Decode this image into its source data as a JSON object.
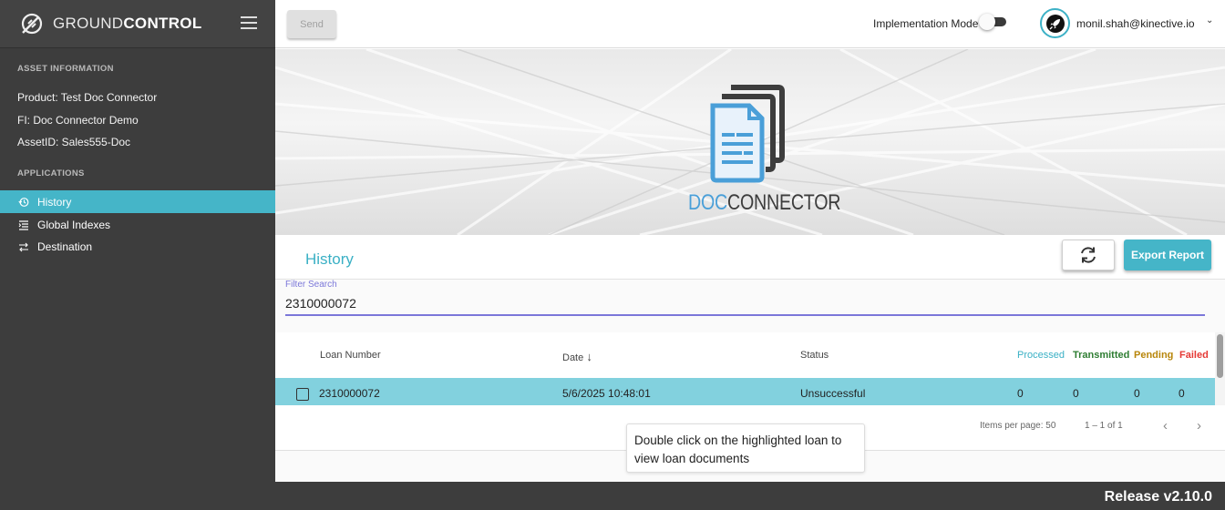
{
  "brand": {
    "name_light": "GROUND",
    "name_bold": "CONTROL"
  },
  "asset_info": {
    "section_title": "ASSET INFORMATION",
    "product": "Product:  Test Doc Connector",
    "fi": "FI:  Doc Connector Demo",
    "asset_id": "AssetID:  Sales555-Doc"
  },
  "applications": {
    "section_title": "APPLICATIONS",
    "items": [
      {
        "label": "History",
        "icon": "history-icon",
        "active": true
      },
      {
        "label": "Global Indexes",
        "icon": "list-icon",
        "active": false
      },
      {
        "label": "Destination",
        "icon": "swap-arrows-icon",
        "active": false
      }
    ]
  },
  "topbar": {
    "send_label": "Send",
    "implementation_mode_label": "Implementation Mode",
    "implementation_mode_on": false,
    "user_email": "monil.shah@kinective.io",
    "chevron": "⌄"
  },
  "banner": {
    "logo_doc": "DOC",
    "logo_connector": "CONNECTOR"
  },
  "history": {
    "title": "History",
    "export_label": "Export Report"
  },
  "filter": {
    "label": "Filter Search",
    "value": "2310000072"
  },
  "table": {
    "headers": {
      "loan_number": "Loan Number",
      "date": "Date",
      "date_sort": "↓",
      "status": "Status",
      "processed": "Processed",
      "transmitted": "Transmitted",
      "pending": "Pending",
      "failed": "Failed"
    },
    "rows": [
      {
        "loan_number": "2310000072",
        "date": "5/6/2025 10:48:01",
        "status": "Unsuccessful",
        "processed": "0",
        "transmitted": "0",
        "pending": "0",
        "failed": "0"
      }
    ]
  },
  "pagination": {
    "items_per_page": "Items per page: 50",
    "range": "1 – 1 of 1",
    "prev": "‹",
    "next": "›"
  },
  "tooltip": {
    "text": "Double click on the highlighted loan to view loan documents"
  },
  "footer": {
    "release": "Release v2.10.0"
  },
  "colors": {
    "accent": "#45b5c8",
    "sidebar": "#3d3d3d",
    "filter_underline": "#7b77d9",
    "row_highlight": "#82d1de"
  }
}
